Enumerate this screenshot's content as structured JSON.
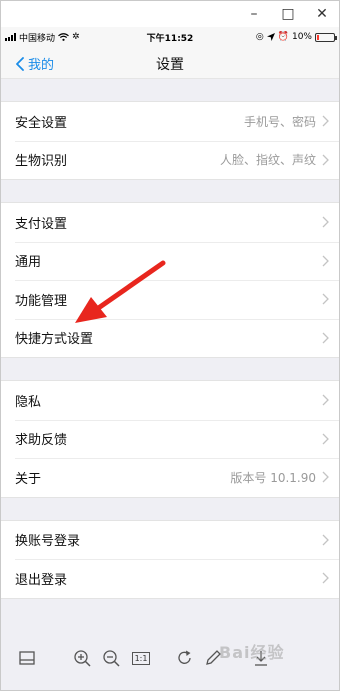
{
  "window": {
    "minimize": "–",
    "maximize": "□",
    "close": "✕"
  },
  "statusbar": {
    "carrier": "中国移动",
    "time": "下午11:52",
    "battery": "10%",
    "battery_level": 0.1
  },
  "navbar": {
    "back_label": "我的",
    "title": "设置"
  },
  "groups": [
    [
      {
        "label": "安全设置",
        "value": "手机号、密码"
      },
      {
        "label": "生物识别",
        "value": "人脸、指纹、声纹"
      }
    ],
    [
      {
        "label": "支付设置",
        "value": ""
      },
      {
        "label": "通用",
        "value": ""
      },
      {
        "label": "功能管理",
        "value": ""
      },
      {
        "label": "快捷方式设置",
        "value": ""
      }
    ],
    [
      {
        "label": "隐私",
        "value": ""
      },
      {
        "label": "求助反馈",
        "value": ""
      },
      {
        "label": "关于",
        "value": "版本号 10.1.90"
      }
    ],
    [
      {
        "label": "换账号登录",
        "value": ""
      },
      {
        "label": "退出登录",
        "value": ""
      }
    ]
  ],
  "toolbar": {
    "icons": [
      "panel-icon",
      "zoom-in-icon",
      "zoom-out-icon",
      "actual-size-icon",
      "rotate-icon",
      "edit-icon",
      "download-icon"
    ],
    "actual_size_label": "1:1"
  },
  "accent_color": "#1a8ce8",
  "annotation_arrow_color": "#e8261e"
}
